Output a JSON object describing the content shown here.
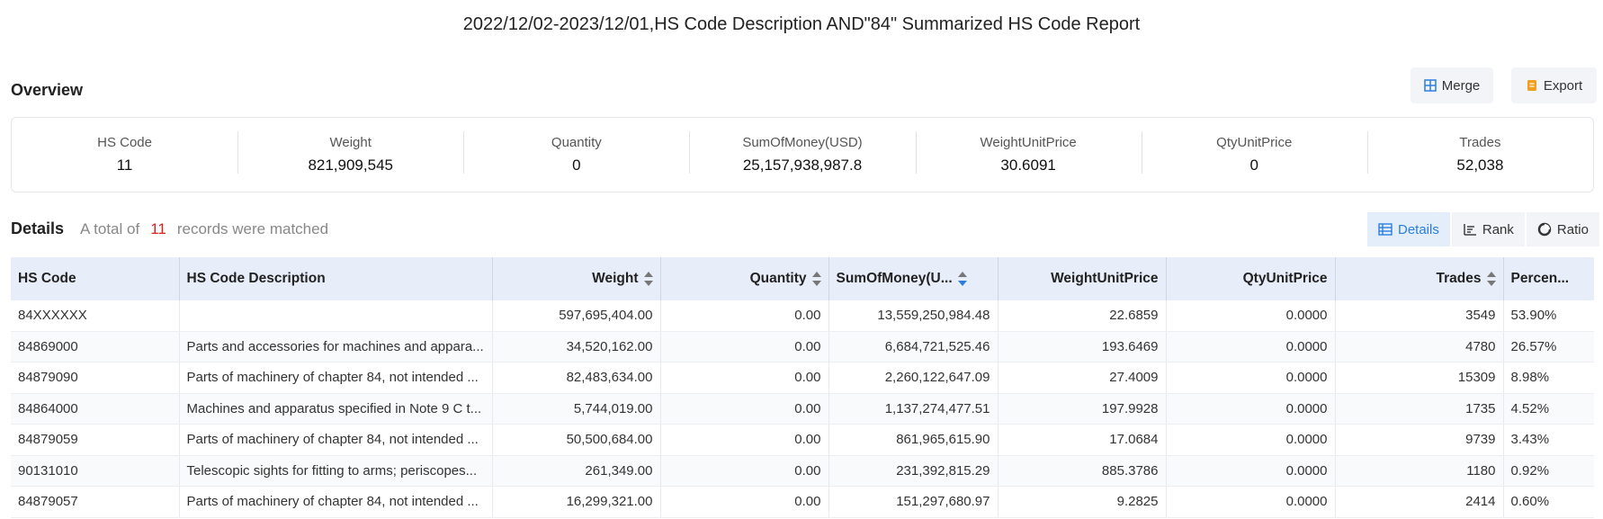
{
  "report_title": "2022/12/02-2023/12/01,HS Code Description AND\"84\" Summarized HS Code Report",
  "overview": {
    "title": "Overview",
    "merge_label": "Merge",
    "export_label": "Export",
    "stats": [
      {
        "label": "HS Code",
        "value": "11"
      },
      {
        "label": "Weight",
        "value": "821,909,545"
      },
      {
        "label": "Quantity",
        "value": "0"
      },
      {
        "label": "SumOfMoney(USD)",
        "value": "25,157,938,987.8"
      },
      {
        "label": "WeightUnitPrice",
        "value": "30.6091"
      },
      {
        "label": "QtyUnitPrice",
        "value": "0"
      },
      {
        "label": "Trades",
        "value": "52,038"
      }
    ]
  },
  "details": {
    "title": "Details",
    "summary_prefix": "A total of",
    "count": "11",
    "summary_suffix": "records were matched",
    "tabs": [
      {
        "label": "Details",
        "icon": "table-icon",
        "active": true
      },
      {
        "label": "Rank",
        "icon": "bar-chart-icon",
        "active": false
      },
      {
        "label": "Ratio",
        "icon": "pie-chart-icon",
        "active": false
      }
    ],
    "columns": [
      "HS Code",
      "HS Code Description",
      "Weight",
      "Quantity",
      "SumOfMoney(U...",
      "WeightUnitPrice",
      "QtyUnitPrice",
      "Trades",
      "Percen..."
    ],
    "rows": [
      [
        "84XXXXXX",
        "",
        "597,695,404.00",
        "0.00",
        "13,559,250,984.48",
        "22.6859",
        "0.0000",
        "3549",
        "53.90%"
      ],
      [
        "84869000",
        "Parts and accessories for machines and appara...",
        "34,520,162.00",
        "0.00",
        "6,684,721,525.46",
        "193.6469",
        "0.0000",
        "4780",
        "26.57%"
      ],
      [
        "84879090",
        "Parts of machinery of chapter 84, not intended ...",
        "82,483,634.00",
        "0.00",
        "2,260,122,647.09",
        "27.4009",
        "0.0000",
        "15309",
        "8.98%"
      ],
      [
        "84864000",
        "Machines and apparatus specified in Note 9 C t...",
        "5,744,019.00",
        "0.00",
        "1,137,274,477.51",
        "197.9928",
        "0.0000",
        "1735",
        "4.52%"
      ],
      [
        "84879059",
        "Parts of machinery of chapter 84, not intended ...",
        "50,500,684.00",
        "0.00",
        "861,965,615.90",
        "17.0684",
        "0.0000",
        "9739",
        "3.43%"
      ],
      [
        "90131010",
        "Telescopic sights for fitting to arms; periscopes...",
        "261,349.00",
        "0.00",
        "231,392,815.29",
        "885.3786",
        "0.0000",
        "1180",
        "0.92%"
      ],
      [
        "84879057",
        "Parts of machinery of chapter 84, not intended ...",
        "16,299,321.00",
        "0.00",
        "151,297,680.97",
        "9.2825",
        "0.0000",
        "2414",
        "0.60%"
      ]
    ]
  },
  "colors": {
    "accent": "#2a7ee0",
    "count_highlight": "#e02020",
    "header_bg": "#e8eef9",
    "export_icon": "#f0a020"
  }
}
